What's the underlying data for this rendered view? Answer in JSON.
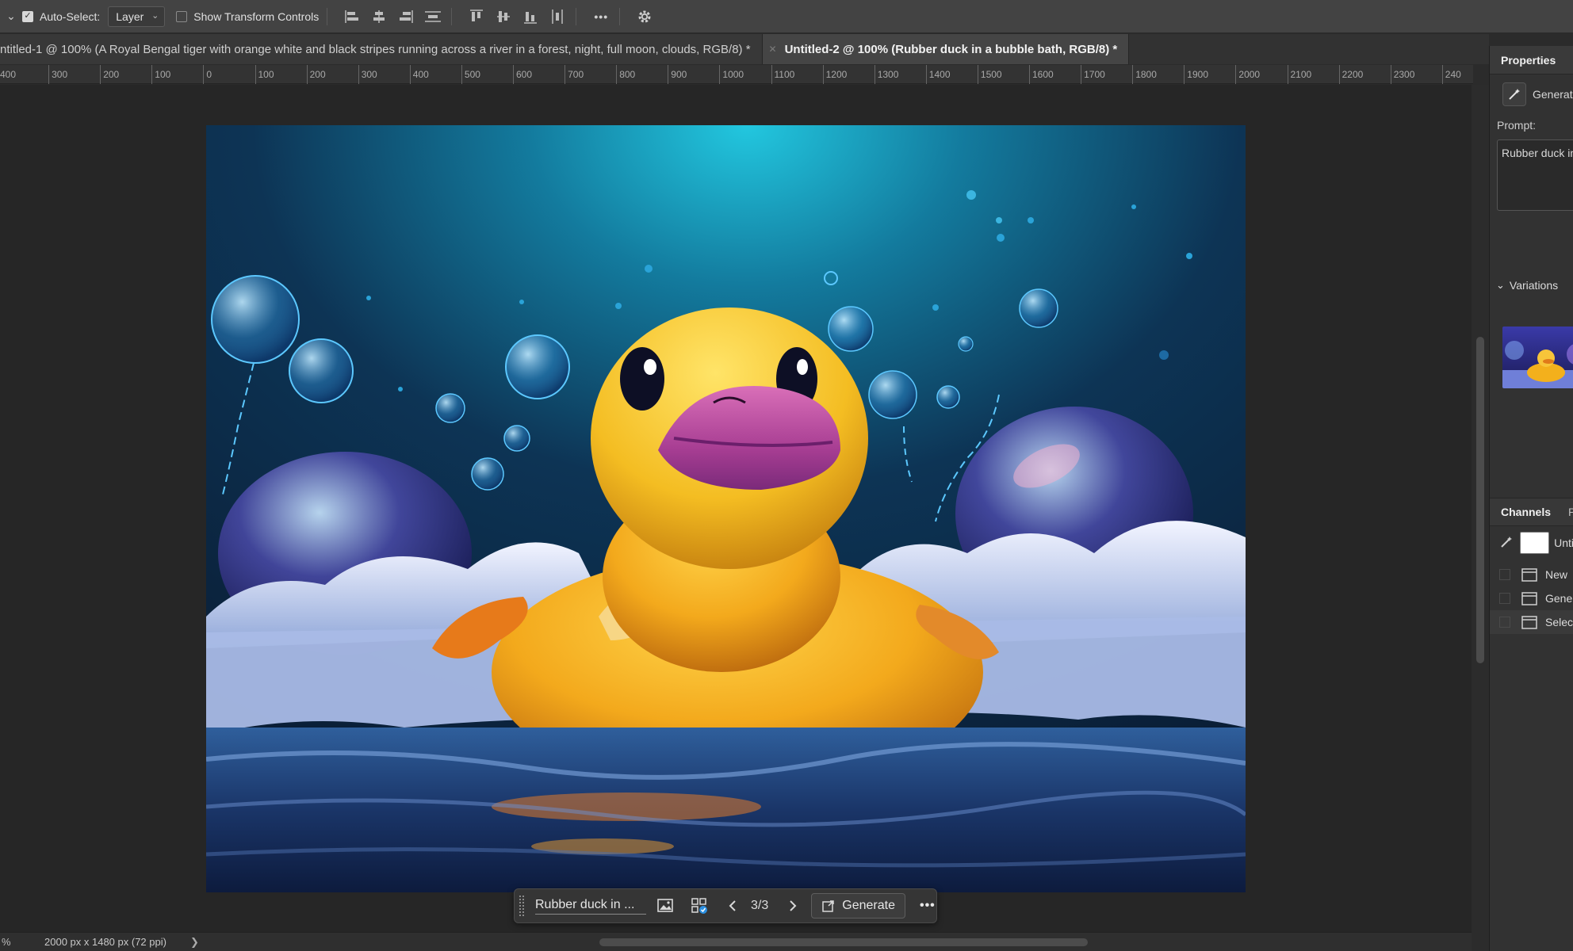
{
  "options_bar": {
    "auto_select_label": "Auto-Select:",
    "auto_select_value": "Layer",
    "show_transform_label": "Show Transform Controls",
    "more_label": "•••"
  },
  "tabs": [
    {
      "label": "ntitled-1 @ 100% (A Royal Bengal tiger with orange white and black stripes running across a river in a forest, night, full moon, clouds, RGB/8) *"
    },
    {
      "label": "Untitled-2 @ 100% (Rubber duck in a bubble bath, RGB/8) *"
    }
  ],
  "ruler": {
    "labels": [
      "400",
      "300",
      "200",
      "100",
      "0",
      "100",
      "200",
      "300",
      "400",
      "500",
      "600",
      "700",
      "800",
      "900",
      "1000",
      "1100",
      "1200",
      "1300",
      "1400",
      "1500",
      "1600",
      "1700",
      "1800",
      "1900",
      "2000",
      "2100",
      "2200",
      "2300",
      "240"
    ]
  },
  "panel": {
    "properties_tab": "Properties",
    "generative_label": "Generati",
    "prompt_label": "Prompt:",
    "prompt_value": "Rubber duck in",
    "variations_label": "Variations",
    "channels_tab": "Channels",
    "channels_tab2": "P",
    "layers": [
      {
        "name": "Unti"
      },
      {
        "name": "New"
      },
      {
        "name": "Gene"
      },
      {
        "name": "Selec"
      }
    ]
  },
  "taskbar": {
    "prompt_text": "Rubber duck in ...",
    "count": "3/3",
    "generate_label": "Generate",
    "more_label": "•••"
  },
  "status": {
    "zoom": "%",
    "doc_size": "2000 px x 1480 px (72 ppi)",
    "arrow": "❯"
  },
  "colors": {
    "accent": "#2b8fe0",
    "duck": "#f2b41c",
    "beak": "#b04a9a"
  }
}
